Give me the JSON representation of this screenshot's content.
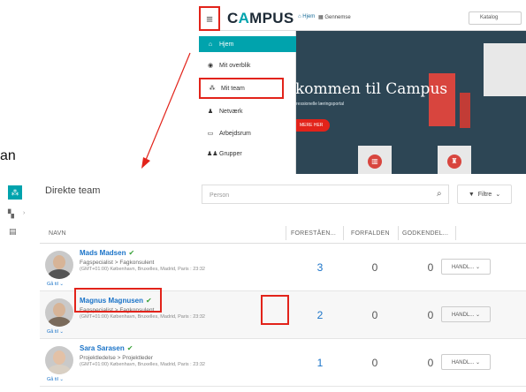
{
  "campus": {
    "logo_pre": "C",
    "logo_a": "A",
    "logo_post": "MPUS",
    "nav": {
      "hjem": "Hjem",
      "gennemse": "Gennemse",
      "katalog": "Katalog"
    },
    "menu": [
      {
        "label": "Hjem",
        "icon": "home-icon",
        "glyph": "⌂"
      },
      {
        "label": "Mit overblik",
        "icon": "person-circle-icon",
        "glyph": "◉"
      },
      {
        "label": "Mit team",
        "icon": "team-icon",
        "glyph": "⁂"
      },
      {
        "label": "Netværk",
        "icon": "person-icon",
        "glyph": "♟"
      },
      {
        "label": "Arbejdsrum",
        "icon": "workspace-icon",
        "glyph": "▭"
      },
      {
        "label": "Grupper",
        "icon": "groups-icon",
        "glyph": "♟♟"
      }
    ],
    "hero": {
      "title": "kommen til Campus",
      "subtitle": "ressionelle læringsportal",
      "button": "MERE HER"
    }
  },
  "annotation_text": "an",
  "team": {
    "title": "Direkte team",
    "search_placeholder": "Person",
    "filter_label": "Filtre",
    "columns": [
      "NAVN",
      "FORESTÅEN...",
      "FORFALDEN",
      "GODKENDEL..."
    ],
    "rows": [
      {
        "name": "Mads Madsen",
        "role": "Fagspecialist > Fagkonsulent",
        "timezone": "(GMT+01:00) København, Bruxelles, Madrid, Paris : 23:32",
        "goto": "Gå til ⌄",
        "forestaaende": "3",
        "forfalden": "0",
        "godkendelse": "0",
        "action": "HANDL... ⌄"
      },
      {
        "name": "Magnus Magnusen",
        "role": "Fagspecialist > Fagkonsulent",
        "timezone": "(GMT+01:00) København, Bruxelles, Madrid, Paris : 23:32",
        "goto": "Gå til ⌄",
        "forestaaende": "2",
        "forfalden": "0",
        "godkendelse": "0",
        "action": "HANDL... ⌄"
      },
      {
        "name": "Sara Sarasen",
        "role": "Projektledelse > Projektleder",
        "timezone": "(GMT+01:00) København, Bruxelles, Madrid, Paris : 23:32",
        "goto": "Gå til ⌄",
        "forestaaende": "1",
        "forfalden": "0",
        "godkendelse": "0",
        "action": "HANDL... ⌄"
      }
    ]
  },
  "colors": {
    "accent": "#00a3ad",
    "highlight": "#e2231a",
    "link": "#1a73c8",
    "hero_bg": "#2d4655"
  }
}
